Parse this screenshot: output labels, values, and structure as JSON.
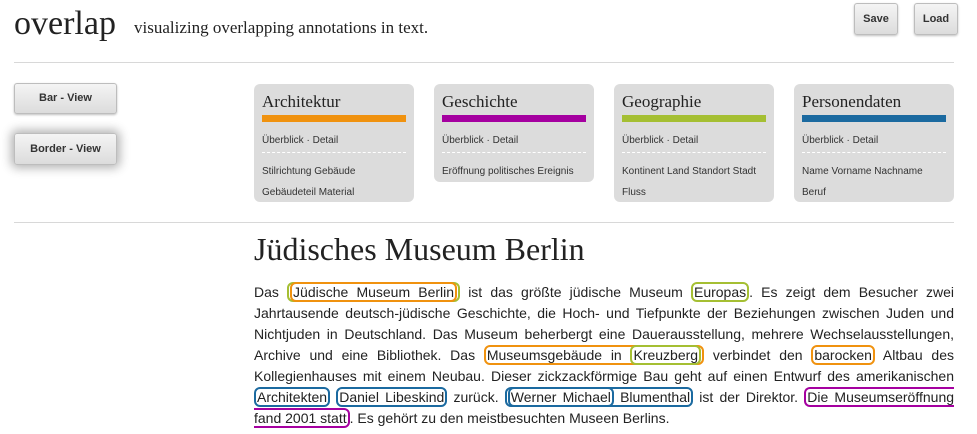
{
  "app": {
    "title": "overlap",
    "subtitle": "visualizing overlapping annotations in text."
  },
  "toolbar": {
    "save_label": "Save",
    "load_label": "Load"
  },
  "views": {
    "bar_label": "Bar - View",
    "border_label": "Border - View",
    "active": "Border - View"
  },
  "colors": {
    "architektur": "#f0920f",
    "geschichte": "#a500a0",
    "geographie": "#a5bf33",
    "personendaten": "#1b6aa0"
  },
  "categories": [
    {
      "title": "Architektur",
      "overview": "Überblick",
      "separator": "·",
      "detail": "Detail",
      "items": [
        "Stilrichtung",
        "Gebäude",
        "Gebäudeteil",
        "Material"
      ]
    },
    {
      "title": "Geschichte",
      "overview": "Überblick",
      "separator": "·",
      "detail": "Detail",
      "items": [
        "Eröffnung",
        "politisches Ereignis"
      ]
    },
    {
      "title": "Geographie",
      "overview": "Überblick",
      "separator": "·",
      "detail": "Detail",
      "items": [
        "Kontinent",
        "Land",
        "Standort",
        "Stadt",
        "Fluss"
      ]
    },
    {
      "title": "Personendaten",
      "overview": "Überblick",
      "separator": "·",
      "detail": "Detail",
      "items": [
        "Name",
        "Vorname",
        "Nachname",
        "Beruf"
      ]
    }
  ],
  "document": {
    "title": "Jüdisches Museum Berlin",
    "t1": "Das ",
    "a1": "Jüdische Museum Berlin",
    "t2": " ist das größte jüdische Museum ",
    "a2": "Europas",
    "t3": ". Es zeigt dem Besucher zwei Jahrtausende deutsch-jüdische Geschichte, die Hoch- und Tiefpunkte der Beziehungen zwischen Juden und Nichtjuden in Deutschland. Das Museum beherbergt eine Dauerausstellung, mehrere Wechselausstellungen, Archive und eine Bibliothek. Das ",
    "a3a": "Museumsgebäude in ",
    "a3b": "Kreuzberg",
    "t4": " verbindet den ",
    "a4": "barocken",
    "t5": " Altbau des Kollegienhauses mit einem Neubau. Dieser zickzackförmige Bau geht auf einen Entwurf des amerikanischen ",
    "a5": "Architekten",
    "t6": " ",
    "a6": "Daniel Libeskind",
    "t7": " zurück. ",
    "a7a": "Werner Michael",
    "a7b": " Blumenthal",
    "t8": " ist der Direktor. ",
    "a8": "Die Museumseröffnung fand 2001 statt",
    "t9": ". Es gehört zu den meistbesuchten Museen Berlins."
  }
}
